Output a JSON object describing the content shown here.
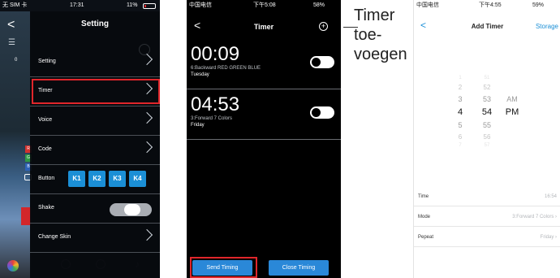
{
  "settings_phone": {
    "status_left": "无 SIM 卡",
    "status_time": "17:31",
    "status_battery": "11%",
    "title": "Setting",
    "side_zero": "0",
    "rgb_labels": [
      "R",
      "G",
      "B"
    ],
    "menu": [
      {
        "label": "Setting"
      },
      {
        "label": "Timer"
      },
      {
        "label": "Voice"
      },
      {
        "label": "Code"
      },
      {
        "label": "Button"
      },
      {
        "label": "Shake"
      },
      {
        "label": "Change Skin"
      }
    ],
    "buttons": [
      "K1",
      "K2",
      "K3",
      "K4"
    ],
    "shake_toggle": "off"
  },
  "timer_phone": {
    "status_left": "中国电信",
    "status_time": "下午5:08",
    "status_battery": "58%",
    "title": "Timer",
    "timers": [
      {
        "time": "00:09",
        "mode": "6:Backward RED GREEN BLUE",
        "day": "Tuesday",
        "enabled": true
      },
      {
        "time": "04:53",
        "mode": "3:Forward 7 Colors",
        "day": "Friday",
        "enabled": true
      }
    ],
    "send_label": "Send Timing",
    "close_label": "Close Timing"
  },
  "callout": {
    "lines": [
      "Timer",
      "toe-",
      "voegen"
    ]
  },
  "add_timer_phone": {
    "status_left": "中国电信",
    "status_time": "下午4:55",
    "status_battery": "59%",
    "title": "Add Timer",
    "storage_label": "Storage",
    "hours": [
      "1",
      "2",
      "3",
      "4",
      "5",
      "6",
      "7"
    ],
    "minutes": [
      "51",
      "52",
      "53",
      "54",
      "55",
      "56",
      "57"
    ],
    "ampm": [
      "AM",
      "PM"
    ],
    "selected": {
      "hour": "4",
      "minute": "54",
      "ampm": "PM"
    },
    "fields": [
      {
        "label": "Time",
        "value": "16:54"
      },
      {
        "label": "Mode",
        "value": "3:Forward 7 Colors"
      },
      {
        "label": "Pepeat",
        "value": "Friday"
      }
    ]
  },
  "colors": {
    "accent": "#1b8fd6",
    "highlight": "#e0262b",
    "timer_button": "#2a88d8"
  }
}
